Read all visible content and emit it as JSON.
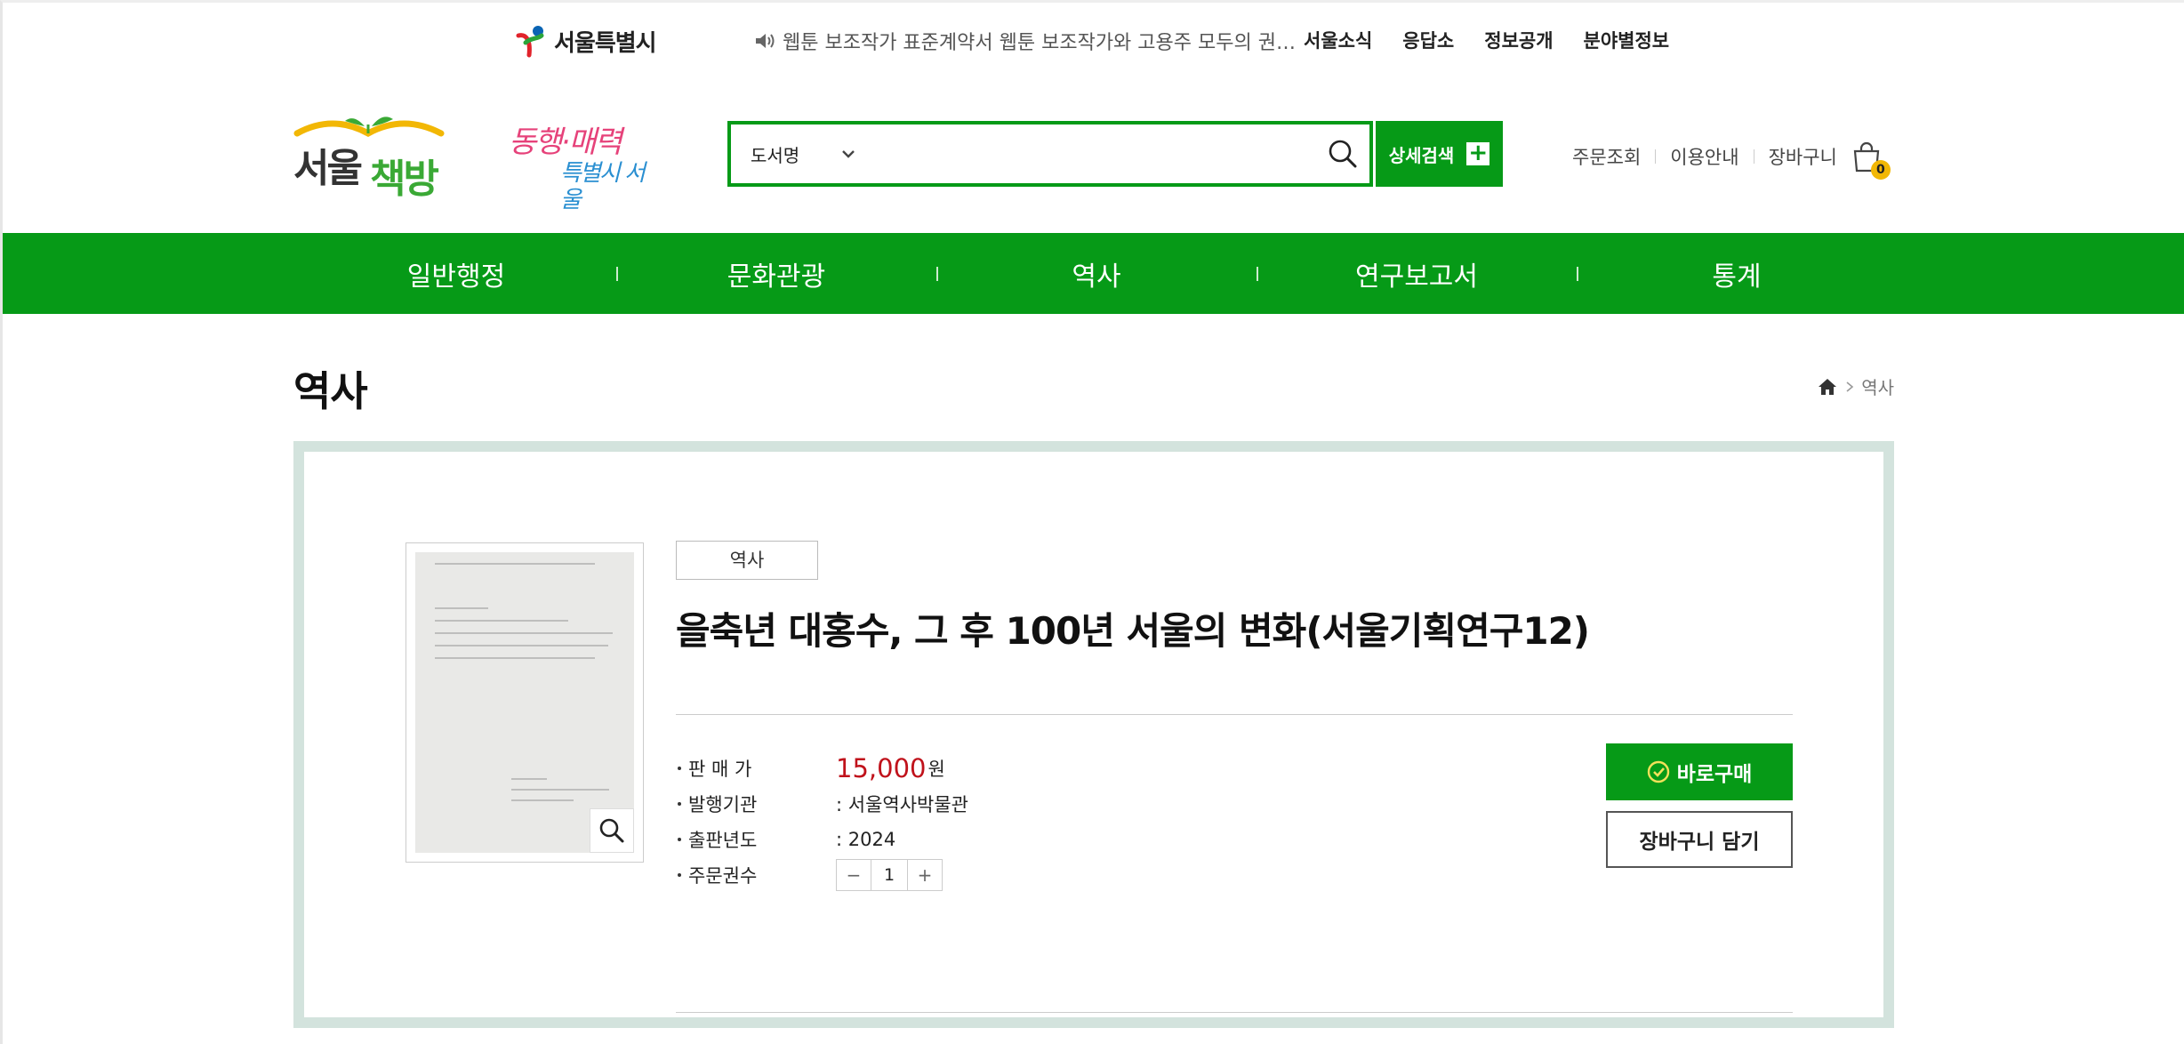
{
  "util": {
    "seoul_logo": "서울특별시",
    "notice": "웹툰 보조작가 표준계약서 웹툰 보조작가와 고용주 모두의 권…",
    "links": [
      "서울소식",
      "응답소",
      "정보공개",
      "분야별정보"
    ]
  },
  "header": {
    "brand": "서울책방",
    "campaign_line1": "동행·매력",
    "campaign_line2": "특별시 서울",
    "search": {
      "select_value": "도서명",
      "placeholder": "",
      "detail_label": "상세검색"
    },
    "member_links": [
      "주문조회",
      "이용안내",
      "장바구니"
    ],
    "cart_count": "0"
  },
  "gnb": [
    "일반행정",
    "문화관광",
    "역사",
    "연구보고서",
    "통계"
  ],
  "page": {
    "title": "역사",
    "breadcrumb_current": "역사"
  },
  "product": {
    "category": "역사",
    "title": "을축년 대홍수, 그 후 100년 서울의 변화(서울기획연구12)",
    "price_label": "판 매 가",
    "price": "15,000",
    "price_unit": "원",
    "publisher_label": "발행기관",
    "publisher": ": 서울역사박물관",
    "year_label": "출판년도",
    "year": ": 2024",
    "qty_label": "주문권수",
    "qty_minus": "−",
    "qty": "1",
    "qty_plus": "+",
    "buy_label": "바로구매",
    "cart_label": "장바구니 담기"
  },
  "colors": {
    "accent": "#069a17",
    "price": "#c0121b",
    "box_border": "#d3e3dd"
  },
  "icons": [
    "seoul-symbol-icon",
    "speaker-icon",
    "chevron-down-icon",
    "search-icon",
    "plus-icon",
    "shopping-bag-icon",
    "home-icon",
    "chevron-right-icon",
    "zoom-icon",
    "check-circle-icon"
  ]
}
